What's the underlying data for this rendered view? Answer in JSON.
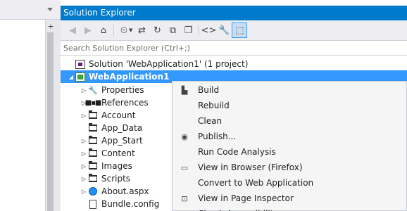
{
  "solution_explorer": {
    "title": "Solution Explorer",
    "search_placeholder": "Search Solution Explorer (Ctrl+;)",
    "toolbar": [
      {
        "name": "back-icon",
        "glyph": "◀",
        "enabled": false
      },
      {
        "name": "forward-icon",
        "glyph": "▶",
        "enabled": false
      },
      {
        "name": "home-icon",
        "glyph": "⌂",
        "enabled": true
      },
      {
        "name": "pending-changes-filter-icon",
        "glyph": "⏲",
        "enabled": true
      },
      {
        "name": "sync-with-active-document-icon",
        "glyph": "⇄",
        "enabled": true
      },
      {
        "name": "refresh-icon",
        "glyph": "↻",
        "enabled": true
      },
      {
        "name": "collapse-all-icon",
        "glyph": "⧉",
        "enabled": true
      },
      {
        "name": "show-all-files-icon",
        "glyph": "❐",
        "enabled": true
      },
      {
        "name": "view-code-icon",
        "glyph": "<>",
        "enabled": true
      },
      {
        "name": "properties-icon",
        "glyph": "🔧",
        "enabled": true
      },
      {
        "name": "preview-selected-items-icon",
        "glyph": "⬚",
        "enabled": true,
        "active": true
      }
    ],
    "tree": [
      {
        "label": "Solution 'WebApplication1' (1 project)",
        "icon": "solution-icon",
        "arrow": "",
        "indent": 0
      },
      {
        "label": "WebApplication1",
        "icon": "web-project-icon",
        "arrow": "◢",
        "indent": 0,
        "selected": true
      },
      {
        "label": "Properties",
        "icon": "wrench-icon",
        "arrow": "▷",
        "indent": 1
      },
      {
        "label": "References",
        "icon": "references-icon",
        "arrow": "▷",
        "indent": 1
      },
      {
        "label": "Account",
        "icon": "folder-icon",
        "arrow": "▷",
        "indent": 1
      },
      {
        "label": "App_Data",
        "icon": "folder-icon",
        "arrow": "",
        "indent": 1
      },
      {
        "label": "App_Start",
        "icon": "folder-icon",
        "arrow": "▷",
        "indent": 1
      },
      {
        "label": "Content",
        "icon": "folder-icon",
        "arrow": "▷",
        "indent": 1
      },
      {
        "label": "Images",
        "icon": "folder-icon",
        "arrow": "▷",
        "indent": 1
      },
      {
        "label": "Scripts",
        "icon": "folder-icon",
        "arrow": "▷",
        "indent": 1
      },
      {
        "label": "About.aspx",
        "icon": "web-page-icon",
        "arrow": "▷",
        "indent": 1
      },
      {
        "label": "Bundle.config",
        "icon": "config-file-icon",
        "arrow": "",
        "indent": 1
      }
    ]
  },
  "context_menu": {
    "items": [
      {
        "label": "Build",
        "icon": "build-icon"
      },
      {
        "label": "Rebuild",
        "icon": ""
      },
      {
        "label": "Clean",
        "icon": ""
      },
      {
        "label": "Publish...",
        "icon": "publish-icon"
      },
      {
        "label": "Run Code Analysis",
        "icon": ""
      },
      {
        "label": "View in Browser (Firefox)",
        "icon": "browser-icon"
      },
      {
        "label": "Convert to Web Application",
        "icon": ""
      },
      {
        "label": "View in Page Inspector",
        "icon": "page-inspector-icon"
      },
      {
        "label": "Check Accessibility...",
        "icon": "accessibility-icon"
      }
    ]
  },
  "colors": {
    "accent": "#007acc",
    "selection": "#3399ff"
  }
}
